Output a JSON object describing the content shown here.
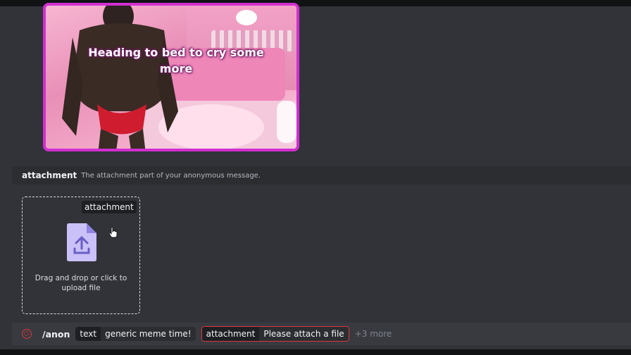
{
  "message": {
    "image_caption": "Heading to bed to cry some more"
  },
  "option_header": {
    "name": "attachment",
    "description": "The attachment part of your anonymous message."
  },
  "dropzone": {
    "label": "attachment",
    "text": "Drag and drop or click to upload file",
    "icon": "file-upload-icon"
  },
  "command_bar": {
    "command": "/anon",
    "options": [
      {
        "name": "text",
        "value": "generic meme time!"
      },
      {
        "name": "attachment",
        "value": "Please attach a file"
      }
    ],
    "more": "+3 more"
  },
  "colors": {
    "background": "#313338",
    "error": "#da373c",
    "accent_icon": "#c9c1f7",
    "image_border": "#d12fd0"
  }
}
